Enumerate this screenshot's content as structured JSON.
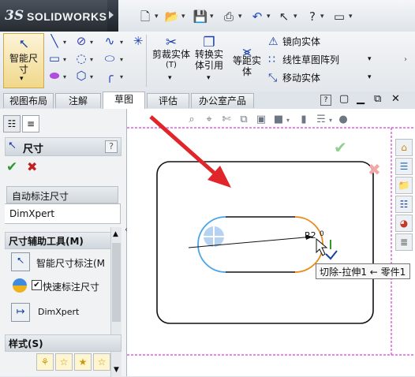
{
  "app": {
    "brand": "SOLIDWORKS",
    "logo_mark": "3S"
  },
  "ribbon": {
    "smart_dim": "智能尺寸",
    "trim": "剪裁实体",
    "trim_hint": "(T)",
    "convert": "转换实体引用",
    "offset": "等距实体",
    "mirror": "镜向实体",
    "linear_pattern": "线性草图阵列",
    "move": "移动实体"
  },
  "tabs": [
    "视图布局",
    "注解",
    "草图",
    "评估",
    "办公室产品"
  ],
  "active_tab": "草图",
  "panel": {
    "title": "尺寸",
    "help": "?",
    "autodim_tab": "自动标注尺寸",
    "dimxpert_tab": "DimXpert",
    "assist_title": "尺寸辅助工具(M)",
    "smart_dim_label": "智能尺寸标注(M",
    "quick_dim_label": "快速标注尺寸",
    "dimxpert_label": "DimXpert",
    "styles_title": "样式(S)"
  },
  "viewport": {
    "dim_text": "R2",
    "dim_value": "0",
    "tooltip": "切除-拉伸1 ← 零件1"
  },
  "colors": {
    "accent_magenta": "#d63dd6",
    "arrow_red": "#e0262a",
    "arc_blue": "#4aa4e8",
    "arc_orange": "#e98a18",
    "active_tab_bg": "#ffffff"
  },
  "icons": [
    "new-file-icon",
    "open-folder-icon",
    "save-icon",
    "print-icon",
    "undo-icon",
    "select-arrow-icon",
    "help-icon",
    "line-icon",
    "rectangle-icon",
    "slot-icon",
    "circle-icon",
    "polygon-icon",
    "spline-icon",
    "ellipse-icon",
    "point-icon",
    "fillet-icon",
    "zoom-fit-icon",
    "zoom-area-icon",
    "section-icon",
    "rotate-icon",
    "display-style-icon",
    "home-icon",
    "library-icon",
    "folder-icon",
    "appearance-icon",
    "properties-icon"
  ]
}
